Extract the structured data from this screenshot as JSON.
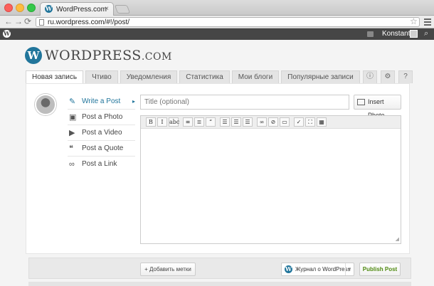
{
  "browser": {
    "tab_title": "WordPress.com",
    "tab_close": "×",
    "url": "ru.wordpress.com/#!/post/",
    "star_icon": "star-icon",
    "back_icon": "←",
    "forward_icon": "→",
    "reload_icon": "⟳"
  },
  "adminbar": {
    "username": "Konstantin",
    "search_icon": "⌕"
  },
  "brand": {
    "logo_letter": "W",
    "name_main": "WORDPRESS",
    "name_suffix": ".COM"
  },
  "tabs": [
    {
      "label": "Новая запись",
      "active": true
    },
    {
      "label": "Чтиво",
      "active": false
    },
    {
      "label": "Уведомления",
      "active": false
    },
    {
      "label": "Статистика",
      "active": false
    },
    {
      "label": "Мои блоги",
      "active": false
    },
    {
      "label": "Популярные записи",
      "active": false
    }
  ],
  "tab_icons": [
    {
      "name": "info-icon",
      "glyph": "ⓘ"
    },
    {
      "name": "gear-icon",
      "glyph": "⚙"
    },
    {
      "name": "help-icon",
      "glyph": "?"
    }
  ],
  "post_menu": [
    {
      "label": "Write a Post",
      "icon": "pin-icon",
      "glyph": "✎",
      "active": true
    },
    {
      "label": "Post a Photo",
      "icon": "camera-icon",
      "glyph": "▣",
      "active": false
    },
    {
      "label": "Post a Video",
      "icon": "film-icon",
      "glyph": "▶",
      "active": false
    },
    {
      "label": "Post a Quote",
      "icon": "quote-icon",
      "glyph": "❝",
      "active": false
    },
    {
      "label": "Post a Link",
      "icon": "link-icon",
      "glyph": "∞",
      "active": false
    }
  ],
  "post_menu_arrow": "▸",
  "editor": {
    "title_placeholder": "Title (optional)",
    "insert_photo_label": "Insert Photo",
    "toolbar": [
      {
        "name": "bold-button",
        "glyph": "B"
      },
      {
        "name": "italic-button",
        "glyph": "I"
      },
      {
        "name": "strikethrough-button",
        "glyph": "abc"
      },
      {
        "sep": true
      },
      {
        "name": "bullet-list-button",
        "glyph": "≡"
      },
      {
        "name": "numbered-list-button",
        "glyph": "≣"
      },
      {
        "name": "blockquote-button",
        "glyph": "“"
      },
      {
        "sep": true
      },
      {
        "name": "align-left-button",
        "glyph": "☰"
      },
      {
        "name": "align-center-button",
        "glyph": "☰"
      },
      {
        "name": "align-right-button",
        "glyph": "☰"
      },
      {
        "sep": true
      },
      {
        "name": "link-button",
        "glyph": "∞"
      },
      {
        "name": "unlink-button",
        "glyph": "⊘"
      },
      {
        "name": "more-button",
        "glyph": "▭"
      },
      {
        "sep": true
      },
      {
        "name": "spellcheck-button",
        "glyph": "✓"
      },
      {
        "name": "fullscreen-button",
        "glyph": "⛶"
      },
      {
        "name": "kitchen-sink-button",
        "glyph": "▦"
      }
    ]
  },
  "bottom": {
    "tags_button": "+ Добавить метки",
    "blog_name": "Журнал о WordPress",
    "blog_arrow": "▾",
    "publish_button": "Publish Post"
  }
}
